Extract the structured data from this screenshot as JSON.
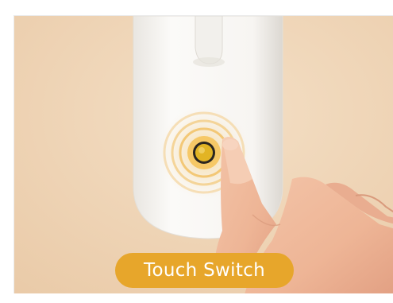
{
  "image": {
    "badge_text": "Touch Switch",
    "colors": {
      "background": "#f0d6b8",
      "lamp_base": "#f7f6f4",
      "accent_ring": "#f2c06a",
      "button_core": "#e0b31f",
      "badge": "#e7a62b"
    }
  }
}
